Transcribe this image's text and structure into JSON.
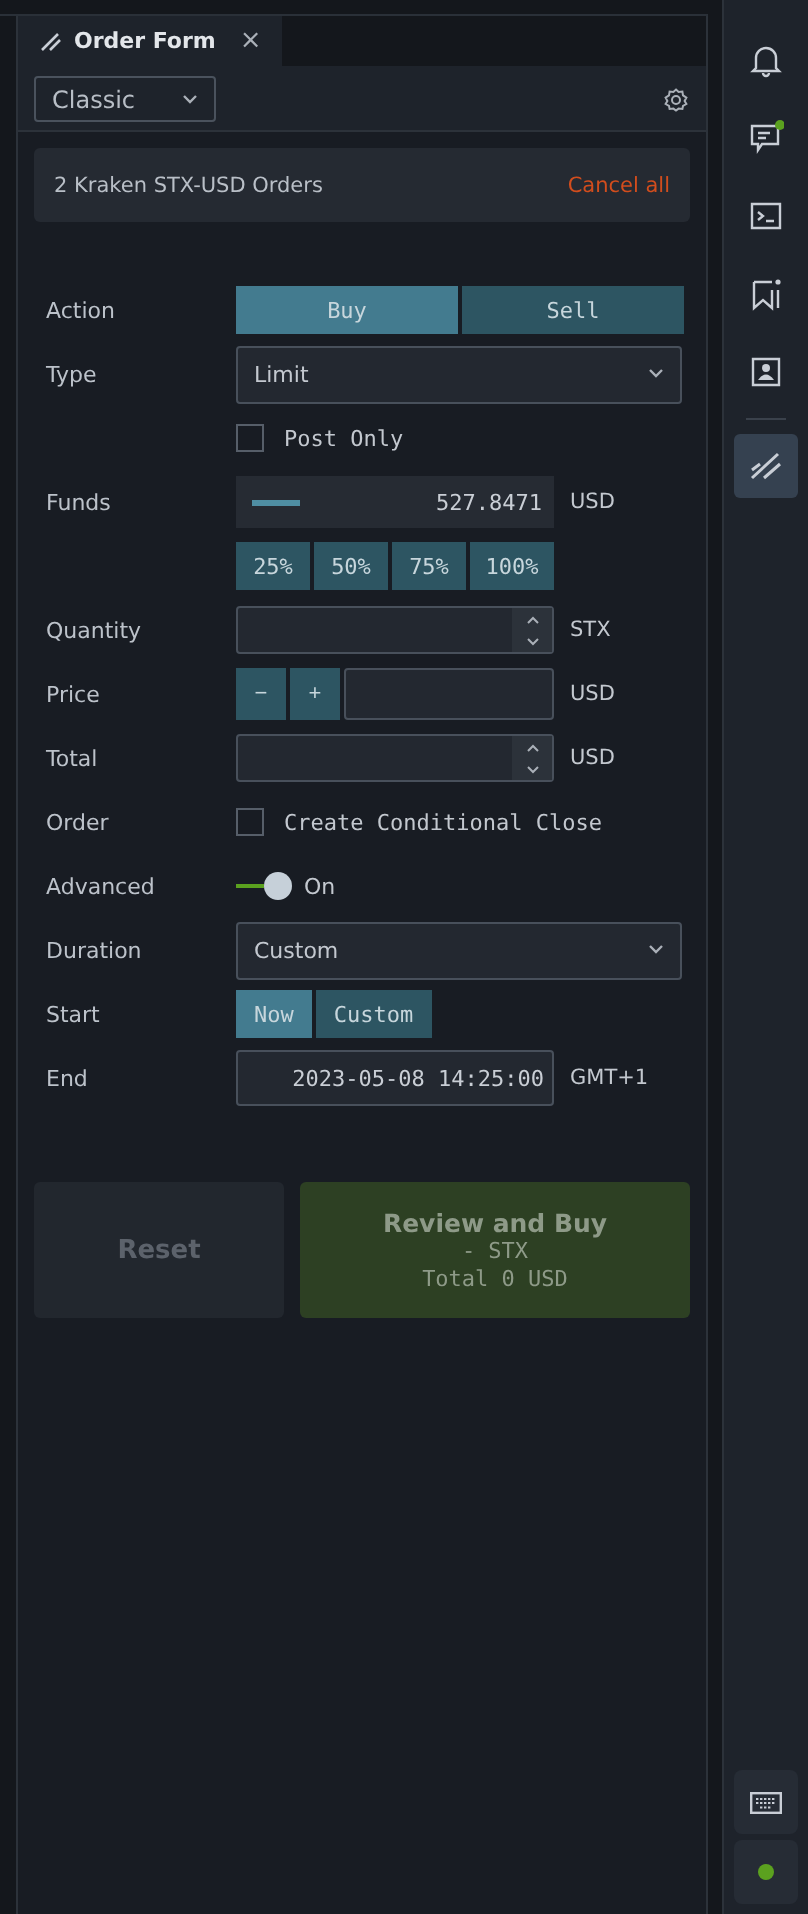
{
  "tab": {
    "title": "Order Form",
    "close": "×",
    "selected": true
  },
  "toolbar": {
    "mode_select": "Classic"
  },
  "orders_banner": {
    "text": "2 Kraken STX-USD Orders",
    "action": "Cancel all"
  },
  "form": [
    {
      "kind": "segmented",
      "label": "Action",
      "options": [
        {
          "label": "Buy",
          "selected": true
        },
        {
          "label": "Sell",
          "selected": false
        }
      ]
    },
    {
      "kind": "select",
      "label": "Type",
      "value": "Limit"
    },
    {
      "kind": "checkbox",
      "text": "Post Only",
      "checked": false
    },
    {
      "kind": "funds",
      "label": "Funds",
      "value": "527.8471",
      "unit": "USD"
    },
    {
      "kind": "chips",
      "options": [
        "25%",
        "50%",
        "75%",
        "100%"
      ]
    },
    {
      "kind": "spinner",
      "label": "Quantity",
      "unit": "STX"
    },
    {
      "kind": "stepper",
      "label": "Price",
      "minus": "−",
      "plus": "+",
      "unit": "USD"
    },
    {
      "kind": "spinner",
      "label": "Total",
      "unit": "USD"
    },
    {
      "kind": "checkbox",
      "label": "Order",
      "text": "Create Conditional Close",
      "checked": false
    },
    {
      "kind": "toggle",
      "label": "Advanced",
      "on": true,
      "text": "On"
    },
    {
      "kind": "select",
      "label": "Duration",
      "value": "Custom"
    },
    {
      "kind": "pills",
      "label": "Start",
      "options": [
        {
          "label": "Now",
          "selected": true
        },
        {
          "label": "Custom",
          "selected": false
        }
      ]
    },
    {
      "kind": "datetime",
      "label": "End",
      "value": "2023-05-08 14:25:00",
      "unit": "GMT+1"
    }
  ],
  "buttons": {
    "reset": {
      "label": "Reset",
      "disabled": true
    },
    "submit": {
      "title": "Review and Buy",
      "lines": [
        "- STX",
        "Total 0 USD"
      ]
    }
  },
  "sidebar": {
    "items": [
      {
        "kind": "bell",
        "selected": false,
        "badge": false
      },
      {
        "kind": "chat",
        "selected": false,
        "badge": true
      },
      {
        "kind": "terminal",
        "selected": false,
        "badge": false
      },
      {
        "kind": "bookmark",
        "selected": false,
        "badge": false
      },
      {
        "kind": "contact",
        "selected": false,
        "badge": false
      },
      {
        "kind": "divider"
      },
      {
        "kind": "order",
        "selected": true,
        "badge": false
      }
    ],
    "bottom": [
      {
        "kind": "keyboard"
      },
      {
        "kind": "status",
        "color": "#5ba11f"
      }
    ]
  }
}
